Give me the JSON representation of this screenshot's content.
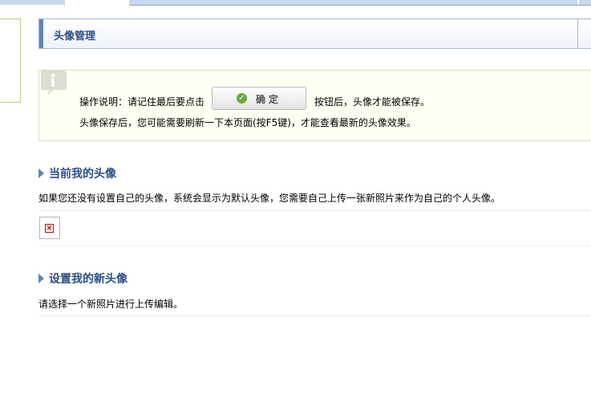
{
  "header": {
    "title": "头像管理"
  },
  "notice": {
    "line1_before": "操作说明：请记住最后要点击",
    "button_label": "确定",
    "line1_after": "按钮后，头像才能被保存。",
    "line2": "头像保存后，您可能需要刷新一下本页面(按F5键)，才能查看最新的头像效果。"
  },
  "current_avatar": {
    "title": "当前我的头像",
    "desc": "如果您还没有设置自己的头像，系统会显示为默认头像，您需要自己上传一张新照片来作为自己的个人头像。"
  },
  "new_avatar": {
    "title": "设置我的新头像",
    "desc": "请选择一个新照片进行上传编辑。"
  },
  "colors": {
    "accent": "#5f83b9",
    "title_text": "#2b4f84",
    "notice_bg": "#fffff3"
  }
}
